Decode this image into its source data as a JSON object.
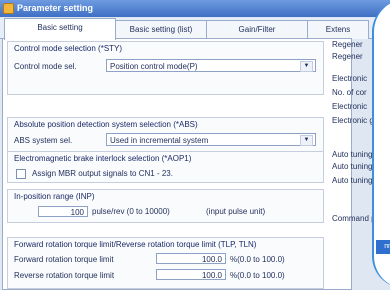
{
  "window": {
    "title": "Parameter setting"
  },
  "tabs": [
    "Basic setting",
    "Basic setting (list)",
    "Gain/Filter",
    "Extens"
  ],
  "control_mode": {
    "group_title": "Control mode selection (*STY)",
    "label": "Control mode sel.",
    "value": "Position control mode(P)"
  },
  "abs": {
    "group_title": "Absolute position detection system selection (*ABS)",
    "label": "ABS system sel.",
    "value": "Used in incremental system"
  },
  "brake": {
    "group_title": "Electromagnetic brake interlock selection (*AOP1)",
    "checkbox_label": "Assign MBR output signals to CN1 - 23."
  },
  "inposition": {
    "group_title": "In-position range (INP)",
    "value": "100",
    "unit": "pulse/rev (0 to 10000)",
    "note": "(input pulse unit)"
  },
  "torque": {
    "group_title": "Forward rotation torque limit/Reverse rotation torque limit (TLP, TLN)",
    "forward_label": "Forward rotation torque limit",
    "forward_value": "100.0",
    "forward_unit": "%(0.0 to 100.0)",
    "reverse_label": "Reverse rotation torque limit",
    "reverse_value": "100.0",
    "reverse_unit": "%(0.0 to 100.0)"
  },
  "right_panel": {
    "regen1": "Regener",
    "regen2": "Regener",
    "electronic": "Electronic",
    "num_of_con": "No. of cor",
    "electronic2": "Electronic",
    "electronic3": "Electronic g",
    "auto1": "Auto tuning r",
    "auto2": "Auto tuning m",
    "auto3": "Auto tuning re",
    "command": "Command p"
  }
}
